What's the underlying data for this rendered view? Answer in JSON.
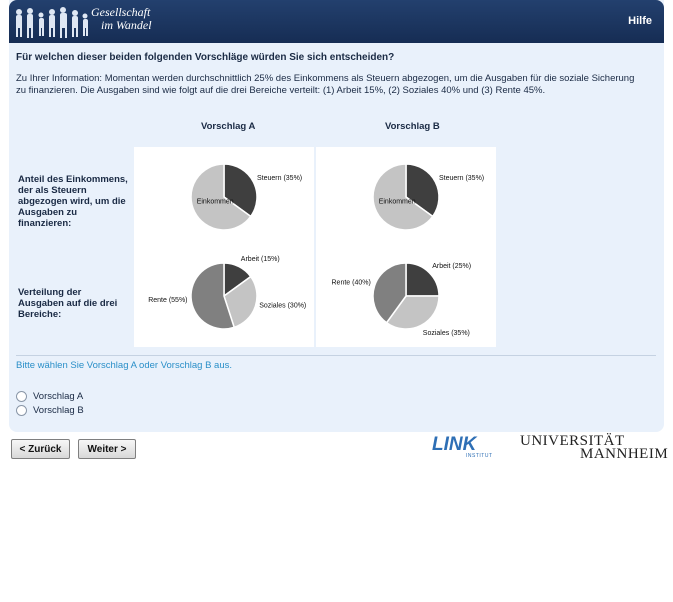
{
  "header": {
    "logo_line1": "Gesellschaft",
    "logo_line2": "im Wandel",
    "help": "Hilfe"
  },
  "question": "Für welchen dieser beiden folgenden Vorschläge würden Sie sich entscheiden?",
  "info": "Zu Ihrer Information: Momentan werden durchschnittlich 25% des Einkommens als Steuern abgezogen, um die Ausgaben für die soziale Sicherung zu finanzieren. Die Ausgaben sind wie folgt auf die drei Bereiche verteilt: (1) Arbeit 15%, (2) Soziales 40% und (3) Rente 45%.",
  "columns": {
    "a": "Vorschlag A",
    "b": "Vorschlag B"
  },
  "rows": {
    "tax": "Anteil des Einkommens, der als Steuern abgezogen wird, um die Ausgaben zu finanzieren:",
    "dist": "Verteilung der Ausgaben auf die drei Bereiche:"
  },
  "charts": {
    "a_tax": {
      "slices": [
        {
          "label": "Steuern (35%)",
          "value": 35,
          "color": "#3f3f3f"
        },
        {
          "label": "Einkommen",
          "value": 65,
          "color": "#c4c4c4"
        }
      ]
    },
    "b_tax": {
      "slices": [
        {
          "label": "Steuern (35%)",
          "value": 35,
          "color": "#3f3f3f"
        },
        {
          "label": "Einkommen",
          "value": 65,
          "color": "#c4c4c4"
        }
      ]
    },
    "a_dist": {
      "slices": [
        {
          "label": "Arbeit (15%)",
          "value": 15,
          "color": "#3f3f3f"
        },
        {
          "label": "Soziales (30%)",
          "value": 30,
          "color": "#c4c4c4"
        },
        {
          "label": "Rente (55%)",
          "value": 55,
          "color": "#808080"
        }
      ]
    },
    "b_dist": {
      "slices": [
        {
          "label": "Arbeit (25%)",
          "value": 25,
          "color": "#3f3f3f"
        },
        {
          "label": "Soziales (35%)",
          "value": 35,
          "color": "#c4c4c4"
        },
        {
          "label": "Rente (40%)",
          "value": 40,
          "color": "#808080"
        }
      ]
    }
  },
  "chart_data": [
    {
      "type": "pie",
      "categories": [
        "Steuern (35%)",
        "Einkommen"
      ],
      "values": [
        35,
        65
      ]
    },
    {
      "type": "pie",
      "categories": [
        "Steuern (35%)",
        "Einkommen"
      ],
      "values": [
        35,
        65
      ]
    },
    {
      "type": "pie",
      "categories": [
        "Arbeit (15%)",
        "Soziales (30%)",
        "Rente (55%)"
      ],
      "values": [
        15,
        30,
        55
      ]
    },
    {
      "type": "pie",
      "categories": [
        "Arbeit (25%)",
        "Soziales (35%)",
        "Rente (40%)"
      ],
      "values": [
        25,
        35,
        40
      ]
    }
  ],
  "prompt": "Bitte wählen Sie Vorschlag A oder Vorschlag B aus.",
  "options": [
    "Vorschlag A",
    "Vorschlag B"
  ],
  "buttons": {
    "back": "< Zurück",
    "next": "Weiter >"
  },
  "footer": {
    "link_logo": "LINK",
    "link_sub": "INSTITUT",
    "uni_line1": "UNIVERSITÄT",
    "uni_line2": "MANNHEIM"
  }
}
